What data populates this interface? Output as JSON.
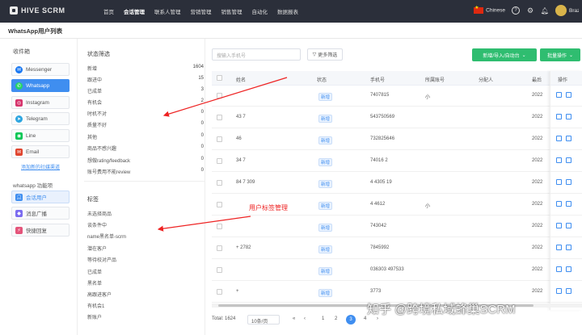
{
  "app": {
    "name": "HIVE SCRM"
  },
  "nav": [
    "首页",
    "会话管理",
    "联系人管理",
    "营销管理",
    "销售管理",
    "自动化",
    "数据报表"
  ],
  "top_right": {
    "language": "Chinese",
    "user": "Brazeny"
  },
  "page_title": "WhatsApp用户列表",
  "sidebar": {
    "inbox_title": "收件箱",
    "channels": [
      {
        "label": "Messenger",
        "icon": "messenger-icon",
        "color": "#1877f2"
      },
      {
        "label": "Whatsapp",
        "icon": "whatsapp-icon",
        "color": "#25d366",
        "active": true
      },
      {
        "label": "Instagram",
        "icon": "instagram-icon",
        "color": "#d6336c"
      },
      {
        "label": "Telegram",
        "icon": "telegram-icon",
        "color": "#2ca5e0"
      },
      {
        "label": "Line",
        "icon": "line-icon",
        "color": "#06c755"
      },
      {
        "label": "Email",
        "icon": "email-icon",
        "color": "#e0452f"
      }
    ],
    "add_link": "添加新的社媒渠道",
    "func_title": "whatsapp 功能项",
    "functions": [
      {
        "label": "会话用户",
        "icon": "users-icon",
        "active": true
      },
      {
        "label": "消息广播",
        "icon": "broadcast-icon"
      },
      {
        "label": "快捷回复",
        "icon": "quick-reply-icon"
      }
    ]
  },
  "status_filter": {
    "title": "状态筛选",
    "items": [
      {
        "label": "新增",
        "count": "1604"
      },
      {
        "label": "跟进中",
        "count": "15"
      },
      {
        "label": "已成单",
        "count": "3"
      },
      {
        "label": "有机会",
        "count": "2"
      },
      {
        "label": "时机不对",
        "count": "0"
      },
      {
        "label": "质量不好",
        "count": "0"
      },
      {
        "label": "其他",
        "count": "0"
      },
      {
        "label": "商品不感兴趣",
        "count": "0"
      },
      {
        "label": "想做rating/feedback",
        "count": "0"
      },
      {
        "label": "账号费用不能review",
        "count": "0"
      }
    ]
  },
  "tags": {
    "title": "标签",
    "items": [
      "未选择商品",
      "谈条件中",
      "name黑名单-scrm",
      "潜在客户",
      "等待校对产品",
      "已成单",
      "黑名单",
      "高跟进客户",
      "有机会1",
      "新账户"
    ]
  },
  "annotations": {
    "user_tag_mgmt": "用户标签管理"
  },
  "toolbar": {
    "search_placeholder": "搜输入手机号",
    "more_filter": "更多筛选",
    "new_btn": "新增/导入/自动台",
    "batch_btn": "批量操作"
  },
  "table": {
    "headers": [
      "姓名",
      "状态",
      "手机号",
      "所属账号",
      "分配人",
      "最后",
      "操作"
    ],
    "rows": [
      {
        "name": "",
        "status": "新增",
        "phone": "7407815",
        "account": "小"
      },
      {
        "name": "43 7",
        "status": "新增",
        "phone": "543750569",
        "account": ""
      },
      {
        "name": "46",
        "status": "新增",
        "phone": "732825646",
        "account": ""
      },
      {
        "name": "34 7",
        "status": "新增",
        "phone": "74016   2",
        "account": ""
      },
      {
        "name": "84 7   309",
        "status": "新增",
        "phone": "4   4305   19",
        "account": ""
      },
      {
        "name": "",
        "status": "新增",
        "phone": "4   4612",
        "account": "小"
      },
      {
        "name": "",
        "status": "新增",
        "phone": "743042",
        "account": ""
      },
      {
        "name": "+   2782",
        "status": "新增",
        "phone": "7845992",
        "account": ""
      },
      {
        "name": "",
        "status": "新增",
        "phone": "036303   497533",
        "account": ""
      },
      {
        "name": "+",
        "status": "新增",
        "phone": "3773",
        "account": ""
      }
    ],
    "last_col": "2022"
  },
  "pagination": {
    "total": "Total: 1624",
    "per_page": "10条/页",
    "pages": [
      "1",
      "2",
      "3",
      "4"
    ],
    "current": "3"
  },
  "watermark": "知乎 @跨境私域蜂巢SCRM"
}
